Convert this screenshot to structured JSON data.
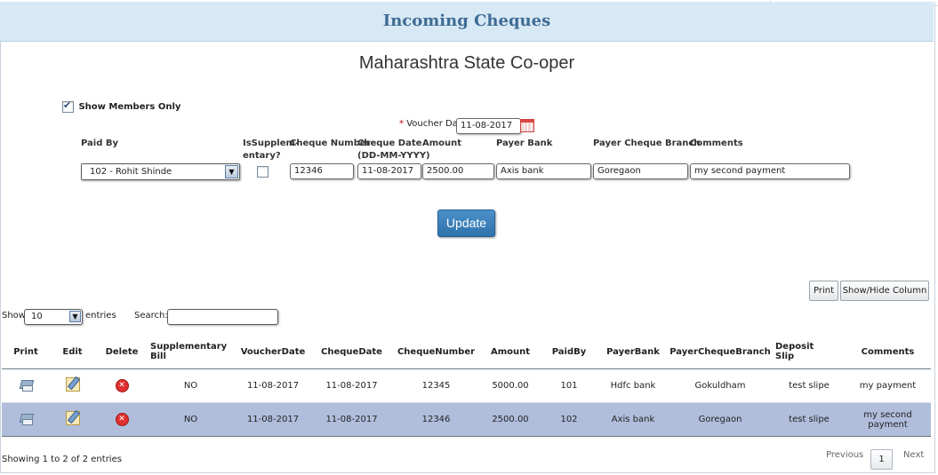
{
  "header": {
    "title": "Incoming Cheques"
  },
  "company": {
    "name": "Maharashtra State Co-oper"
  },
  "form": {
    "show_members_label": "Show Members Only",
    "show_members_checked": true,
    "required_mark": "*",
    "voucher_date_label": "Voucher Date",
    "voucher_date_value": "11-08-2017",
    "calendar_icon": "calendar-icon",
    "columns": {
      "paid_by": "Paid By",
      "is_supp_1": "IsSupplem-",
      "is_supp_2": "entary?",
      "cheque_number": "Cheque Number",
      "cheque_date_1": "Cheque Date",
      "cheque_date_2": "(DD-MM-YYYY)",
      "amount": "Amount",
      "payer_bank": "Payer Bank",
      "payer_cheque_branch": "Payer Cheque Branch",
      "comments": "Comments"
    },
    "values": {
      "paid_by": "102 - Rohit Shinde",
      "is_supplementary": false,
      "cheque_number": "12346",
      "cheque_date": "11-08-2017",
      "amount": "2500.00",
      "payer_bank": "Axis bank",
      "payer_cheque_branch": "Goregaon",
      "comments": "my second payment"
    },
    "update_label": "Update"
  },
  "toolbar": {
    "print_label": "Print",
    "show_hide_label": "Show/Hide Column"
  },
  "table_controls": {
    "show_label": "Show",
    "page_length": "10",
    "entries_label": "entries",
    "search_label": "Search:",
    "search_value": ""
  },
  "table": {
    "headers": {
      "print": "Print",
      "edit": "Edit",
      "delete": "Delete",
      "supp_1": "Supplementary",
      "supp_2": "Bill",
      "voucher_date": "VoucherDate",
      "cheque_date": "ChequeDate",
      "cheque_number": "ChequeNumber",
      "amount": "Amount",
      "paid_by": "PaidBy",
      "payer_bank": "PayerBank",
      "payer_cheque_branch": "PayerChequeBranch",
      "deposit_1": "Deposit",
      "deposit_2": "Slip",
      "comments": "Comments"
    },
    "rows": [
      {
        "supplementary": "NO",
        "voucher_date": "11-08-2017",
        "cheque_date": "11-08-2017",
        "cheque_number": "12345",
        "amount": "5000.00",
        "paid_by": "101",
        "payer_bank": "Hdfc bank",
        "payer_cheque_branch": "Gokuldham",
        "deposit_slip": "test slipe",
        "comments": "my payment"
      },
      {
        "supplementary": "NO",
        "voucher_date": "11-08-2017",
        "cheque_date": "11-08-2017",
        "cheque_number": "12346",
        "amount": "2500.00",
        "paid_by": "102",
        "payer_bank": "Axis bank",
        "payer_cheque_branch": "Goregaon",
        "deposit_slip": "test slipe",
        "comments": "my second payment"
      }
    ]
  },
  "footer": {
    "info": "Showing 1 to 2 of 2 entries",
    "previous": "Previous",
    "page": "1",
    "next": "Next"
  },
  "colors": {
    "header_bg": "#d7e9f5",
    "title": "#3f6b94",
    "selected_row": "#b0bedc",
    "button": "#2f73ad"
  }
}
